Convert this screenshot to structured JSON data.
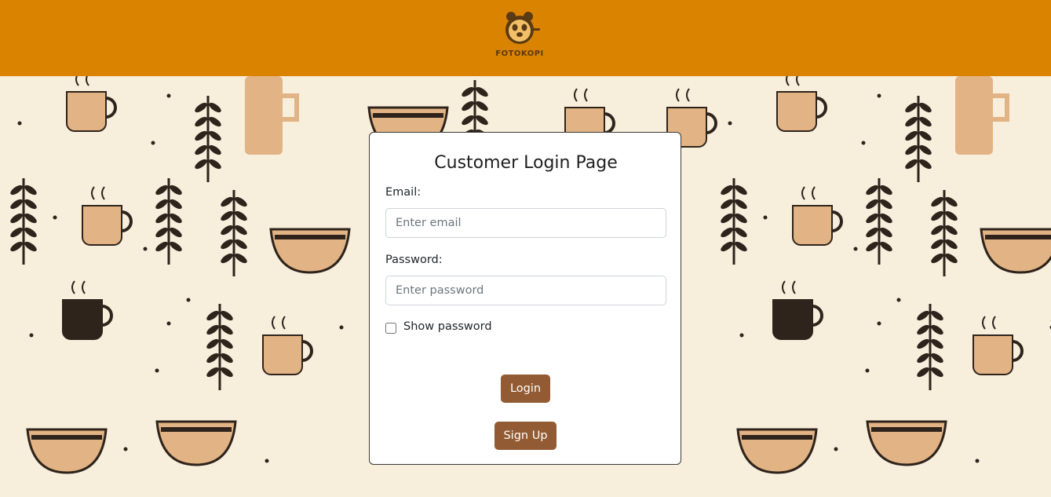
{
  "header": {
    "logo_text": "FOTOKOPI"
  },
  "login": {
    "title": "Customer Login Page",
    "email_label": "Email:",
    "email_placeholder": "Enter email",
    "email_value": "",
    "password_label": "Password:",
    "password_placeholder": "Enter password",
    "password_value": "",
    "show_password_label": "Show password",
    "show_password_checked": false,
    "login_button": "Login",
    "signup_button": "Sign Up"
  },
  "colors": {
    "header_bg": "#d98300",
    "button_bg": "#925b33",
    "pattern_bg": "#f8eedc",
    "ink": "#2f241c",
    "tan": "#e2b384"
  }
}
